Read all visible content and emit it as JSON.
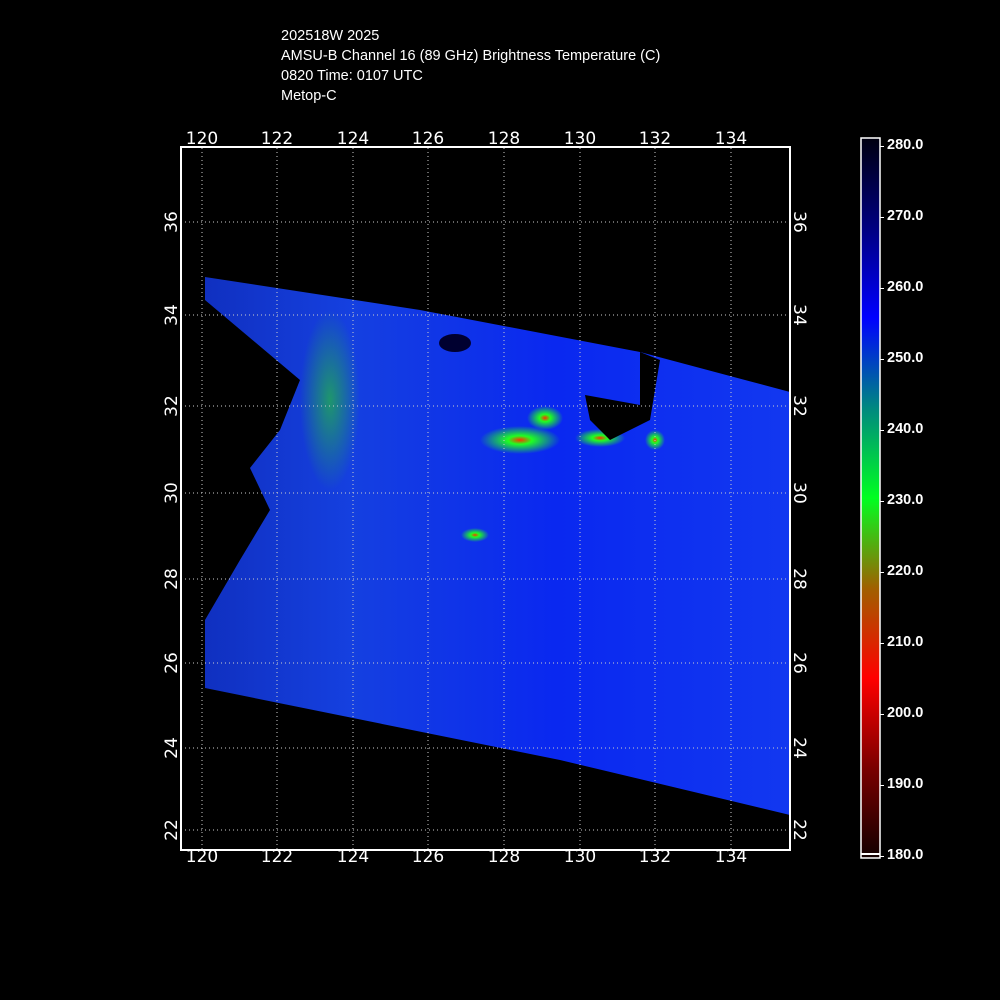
{
  "title": {
    "storm": "202518W 2025",
    "product": "AMSU-B Channel 16 (89 GHz) Brightness Temperature (C)",
    "time": "0820 Time: 0107 UTC",
    "satellite": "Metop-C"
  },
  "map": {
    "lon_ticks": [
      "120",
      "122",
      "124",
      "126",
      "128",
      "130",
      "132",
      "134"
    ],
    "lat_ticks": [
      "36",
      "34",
      "32",
      "30",
      "28",
      "26",
      "24",
      "22"
    ],
    "lon_range": [
      119.5,
      135.5
    ],
    "lat_range": [
      21.5,
      37.6
    ]
  },
  "colorbar": {
    "labels": [
      "280.0",
      "270.0",
      "260.0",
      "250.0",
      "240.0",
      "230.0",
      "220.0",
      "210.0",
      "200.0",
      "190.0",
      "180.0"
    ],
    "range": [
      180,
      280
    ],
    "colors": [
      "#120000",
      "#7a0000",
      "#ff0000",
      "#a06000",
      "#00ff20",
      "#008880",
      "#0000ff",
      "#000080",
      "#000010"
    ]
  }
}
